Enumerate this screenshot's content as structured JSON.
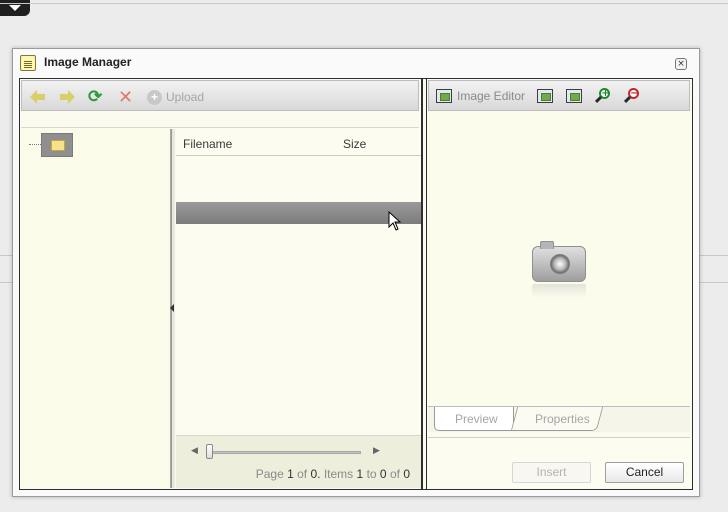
{
  "dialog": {
    "title": "Image Manager",
    "close_glyph": "×"
  },
  "toolbar": {
    "back_icon": "arrow-left-icon",
    "forward_icon": "arrow-right-icon",
    "refresh_glyph": "⟳",
    "delete_glyph": "✕",
    "upload_glyph": "+",
    "upload_label": "Upload"
  },
  "grid": {
    "columns": [
      "Filename",
      "Size"
    ],
    "pager": {
      "prefix": "Page",
      "page": "1",
      "of_text": "of",
      "total_pages": "0.",
      "items_text": "Items",
      "from": "1",
      "to_text": "to",
      "to": "0",
      "of_text2": "of",
      "total_items": "0"
    },
    "prev_glyph": "◀",
    "next_glyph": "▶"
  },
  "editor_toolbar": {
    "image_editor_label": "Image Editor",
    "zoom_in_glyph": "+",
    "zoom_out_glyph": "−"
  },
  "tabs": {
    "preview": "Preview",
    "properties": "Properties"
  },
  "buttons": {
    "insert": "Insert",
    "cancel": "Cancel"
  },
  "colors": {
    "panel_bg": "#fbfbe9",
    "selected_row": "#8a8a8a",
    "zoom_in": "#1f8a2a",
    "zoom_out": "#c42828",
    "refresh": "#2e9a3a"
  }
}
